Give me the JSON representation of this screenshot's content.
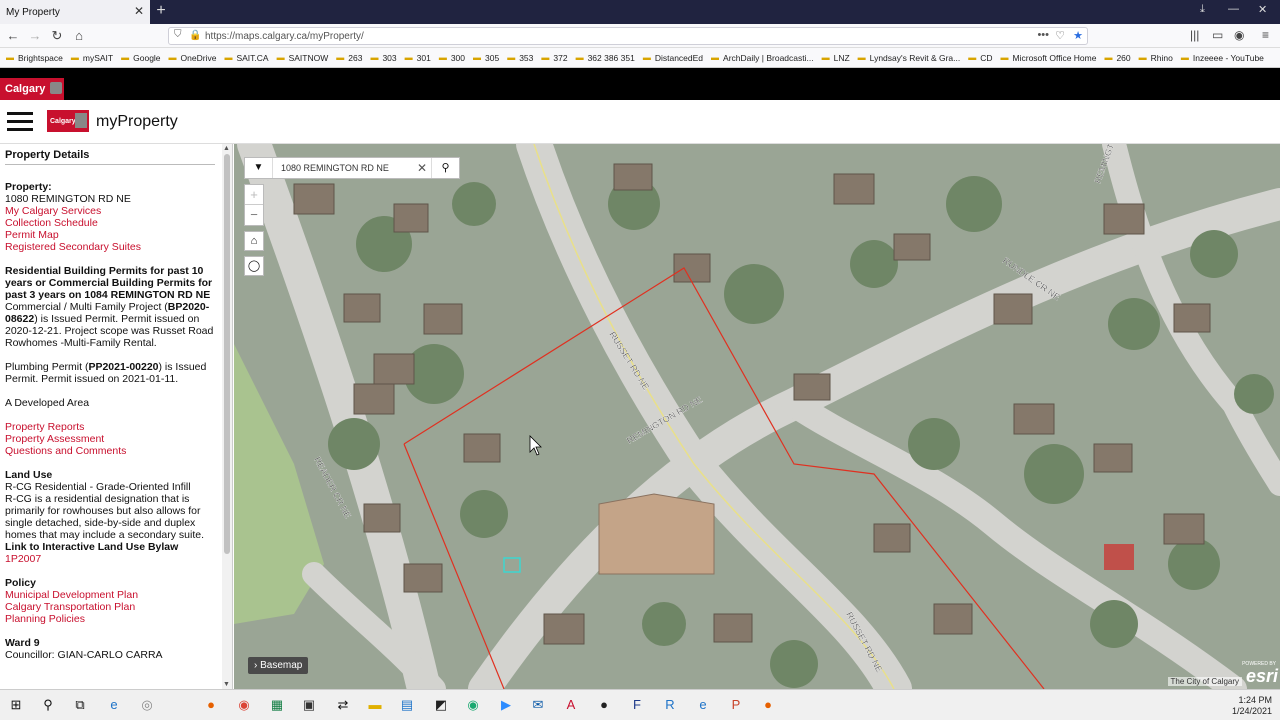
{
  "browser": {
    "tab_title": "My Property",
    "tab_close": "✕",
    "new_tab": "+",
    "url": "https://maps.calgary.ca/myProperty/",
    "bookmarks": [
      "Brightspace",
      "mySAIT",
      "Google",
      "OneDrive",
      "SAIT.CA",
      "SAITNOW",
      "263",
      "303",
      "301",
      "300",
      "305",
      "353",
      "372",
      "362 386 351",
      "DistancedEd",
      "ArchDaily | Broadcasti...",
      "LNZ",
      "Lyndsay's Revit & Gra...",
      "CD",
      "Microsoft Office Home",
      "260",
      "Rhino",
      "Inzeeee - YouTube"
    ]
  },
  "banner": {
    "logo_text": "Calgary"
  },
  "app": {
    "logo_text": "Calgary",
    "title": "myProperty"
  },
  "panel": {
    "title": "Property Details",
    "property_label": "Property:",
    "address": "1080 REMINGTON RD NE",
    "links1": [
      "My Calgary Services",
      "Collection Schedule",
      "Permit Map",
      "Registered Secondary Suites"
    ],
    "permits_heading": "Residential Building Permits for past 10 years or Commercial Building Permits for past 3 years on 1084 REMINGTON RD NE",
    "permit1_pre": "Commercial / Multi Family Project (",
    "permit1_id": "BP2020-08622",
    "permit1_post": ") is Issued Permit. Permit issued on 2020-12-21. Project scope was Russet Road Rowhomes -Multi-Family Rental.",
    "permit2_pre": "Plumbing Permit (",
    "permit2_id": "PP2021-00220",
    "permit2_post": ") is Issued Permit. Permit issued on 2021-01-11.",
    "developed": "A Developed Area",
    "links2": [
      "Property Reports",
      "Property Assessment",
      "Questions and Comments"
    ],
    "land_use_label": "Land Use",
    "land_use_zone": "R-CG Residential - Grade-Oriented Infill",
    "land_use_desc": "R-CG is a residential designation that is primarily for rowhouses but also allows for single detached, side-by-side and duplex homes that may include a secondary suite.",
    "bylaw_label": "Link to Interactive Land Use Bylaw",
    "bylaw_link": "1P2007",
    "policy_label": "Policy",
    "policy_links": [
      "Municipal Development Plan",
      "Calgary Transportation Plan",
      "Planning Policies"
    ],
    "ward_label": "Ward 9",
    "councillor": "Councillor: GIAN-CARLO CARRA"
  },
  "map": {
    "search_value": "1080 REMINGTON RD NE",
    "basemap_label": "Basemap",
    "attribution": "The City of Calgary",
    "esri": "esri",
    "esri_powered": "POWERED BY",
    "street_labels": [
      "RUSSET RD NE",
      "REMINGTON RD NE",
      "READER CR NE",
      "RUNDLE CR NE",
      "RUSSET RD NE",
      "REMINGTO"
    ]
  },
  "taskbar": {
    "time": "1:24 PM",
    "date": "1/24/2021"
  },
  "colors": {
    "brand_red": "#c8102e",
    "link": "#c8102e",
    "parcel_line": "#e03020"
  }
}
